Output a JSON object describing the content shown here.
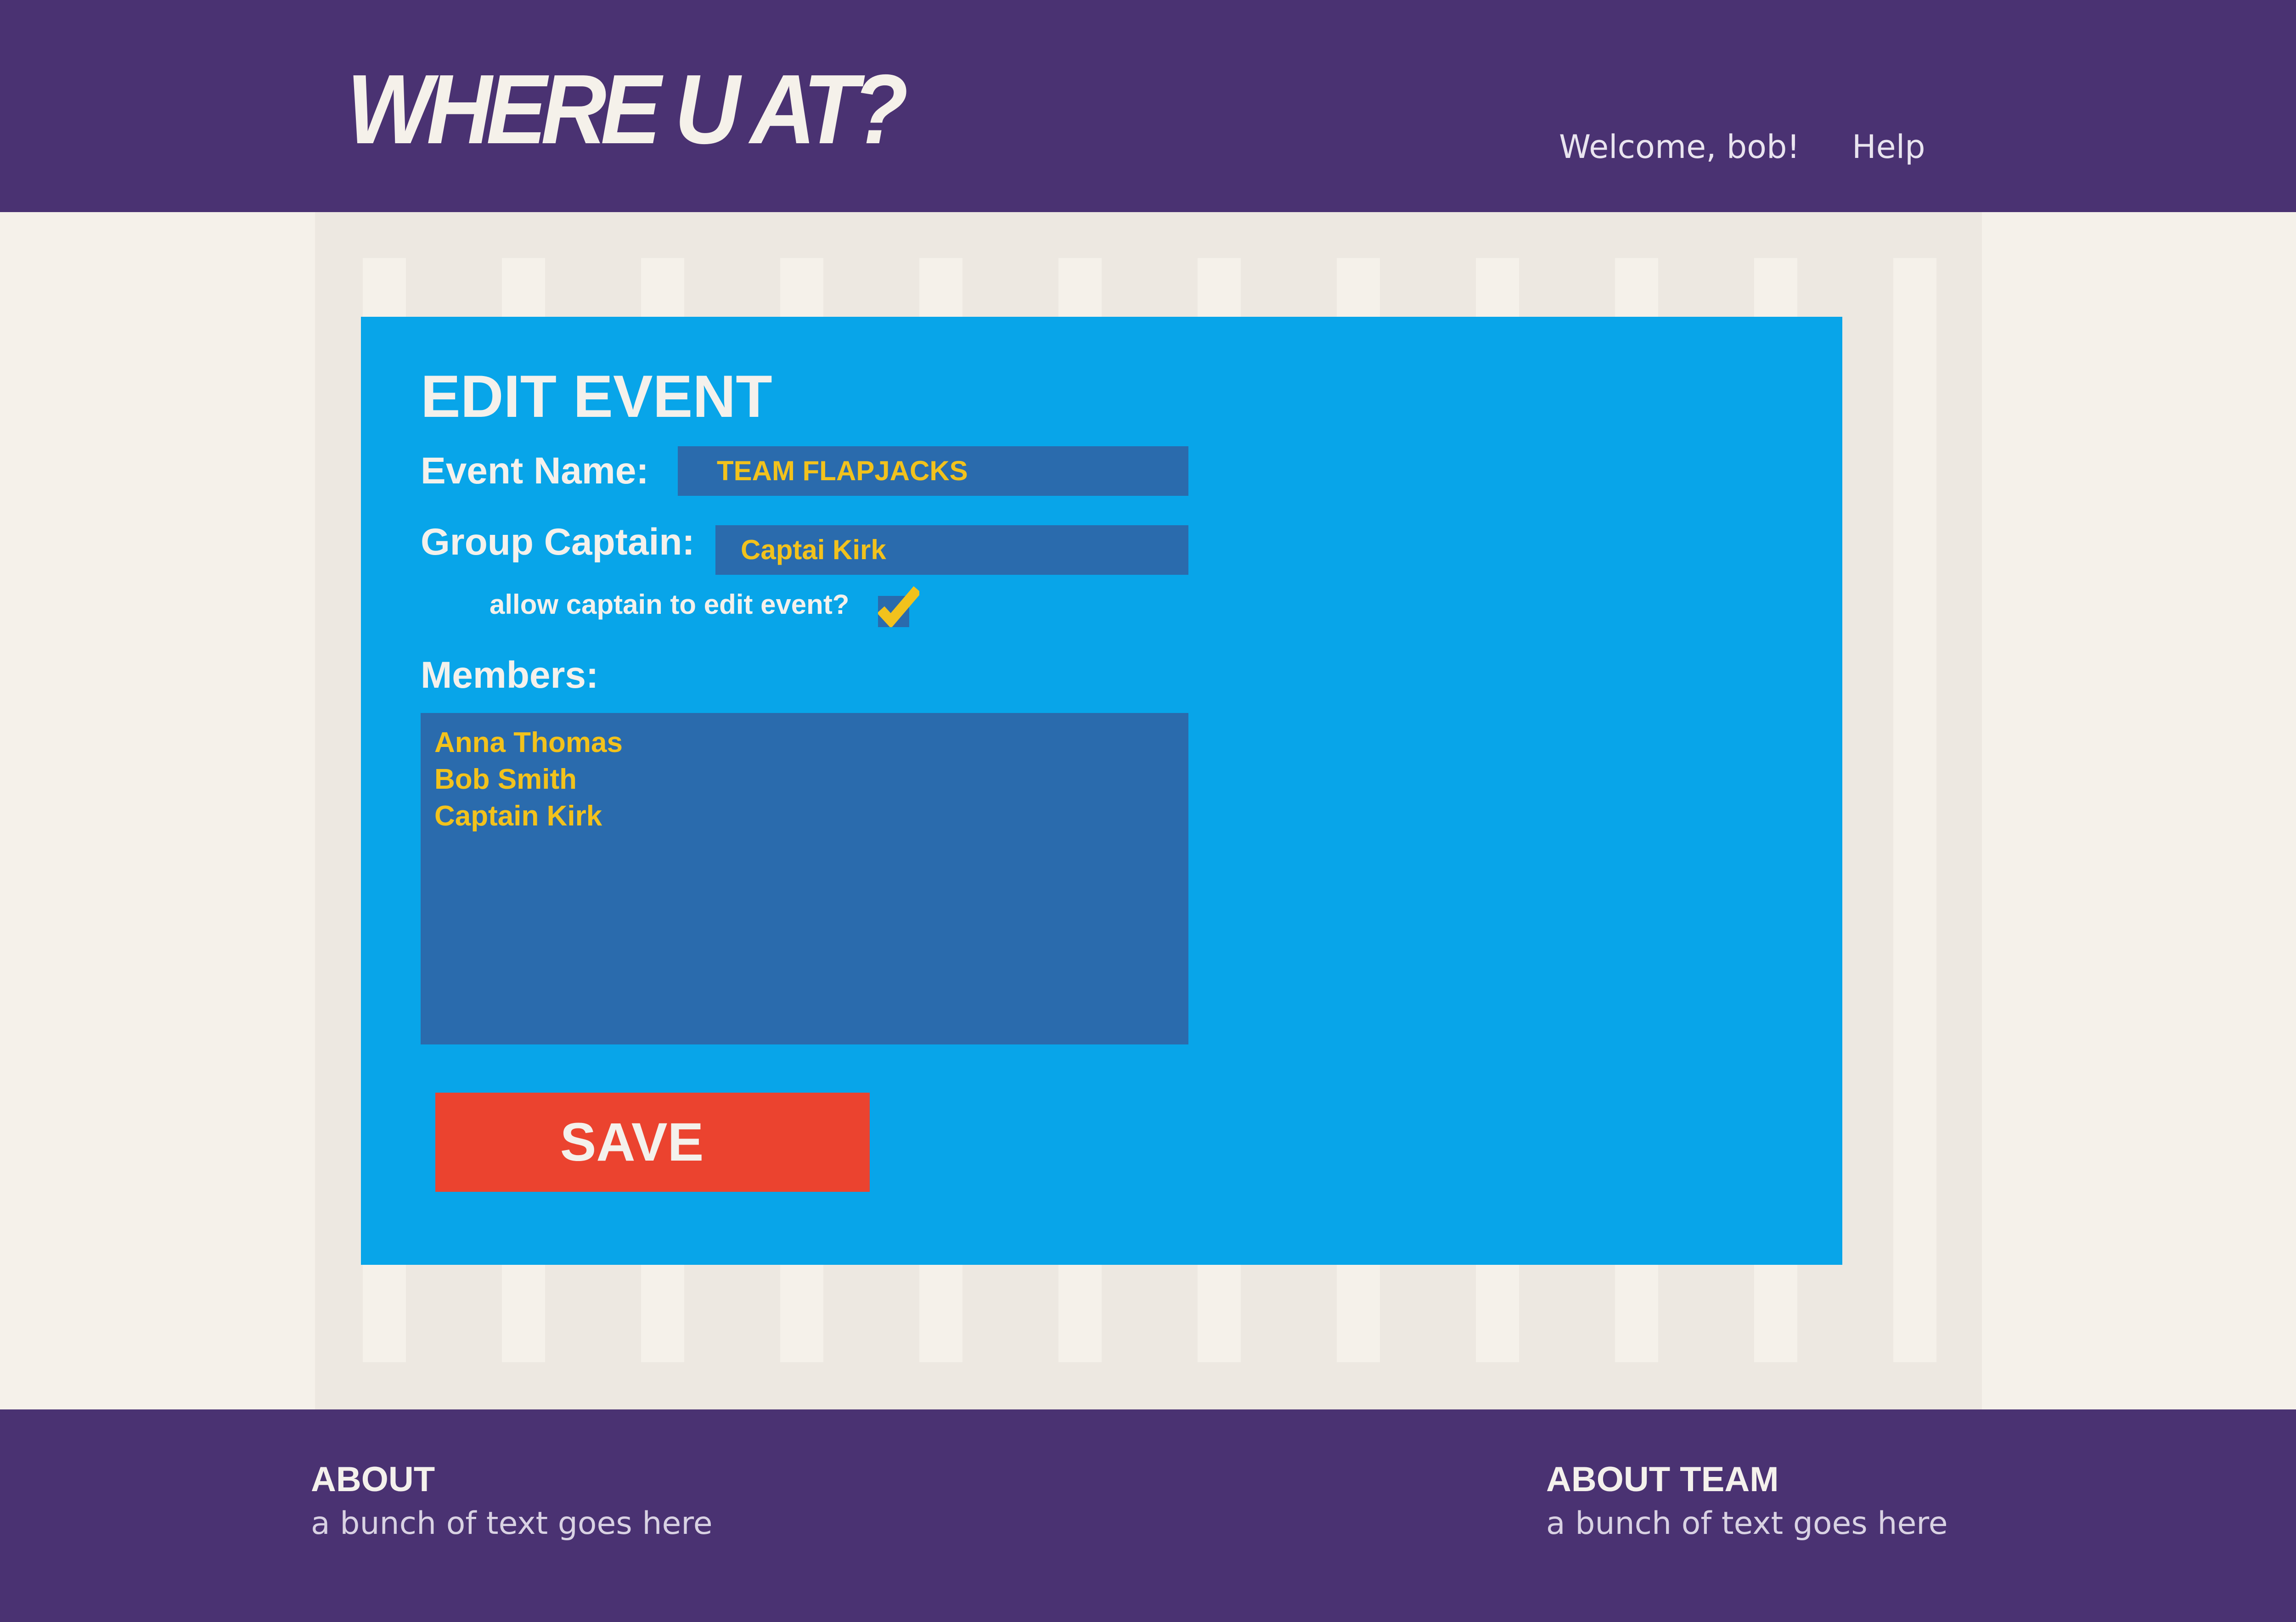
{
  "header": {
    "logo": "WHERE U AT?",
    "welcome": "Welcome, bob!",
    "help": "Help"
  },
  "form": {
    "title": "EDIT EVENT",
    "event_name_label": "Event Name:",
    "event_name_value": "TEAM FLAPJACKS",
    "group_captain_label": "Group Captain:",
    "group_captain_value": "Captai Kirk",
    "allow_edit_label": "allow captain to edit event?",
    "allow_edit_checked": true,
    "members_label": "Members:",
    "members": [
      "Anna Thomas",
      "Bob Smith",
      "Captain Kirk"
    ],
    "save_label": "SAVE"
  },
  "footer": {
    "about_title": "ABOUT",
    "about_text": "a bunch of text goes here",
    "team_title": "ABOUT TEAM",
    "team_text": "a bunch of text goes here"
  },
  "colors": {
    "header_bg": "#4a3272",
    "card_bg": "#08a5e9",
    "field_bg": "#2a6bad",
    "field_text": "#f2c21c",
    "save_bg": "#eb432f",
    "page_bg": "#f5f1ea"
  },
  "icons": {
    "checkbox": "checkmark-icon"
  }
}
